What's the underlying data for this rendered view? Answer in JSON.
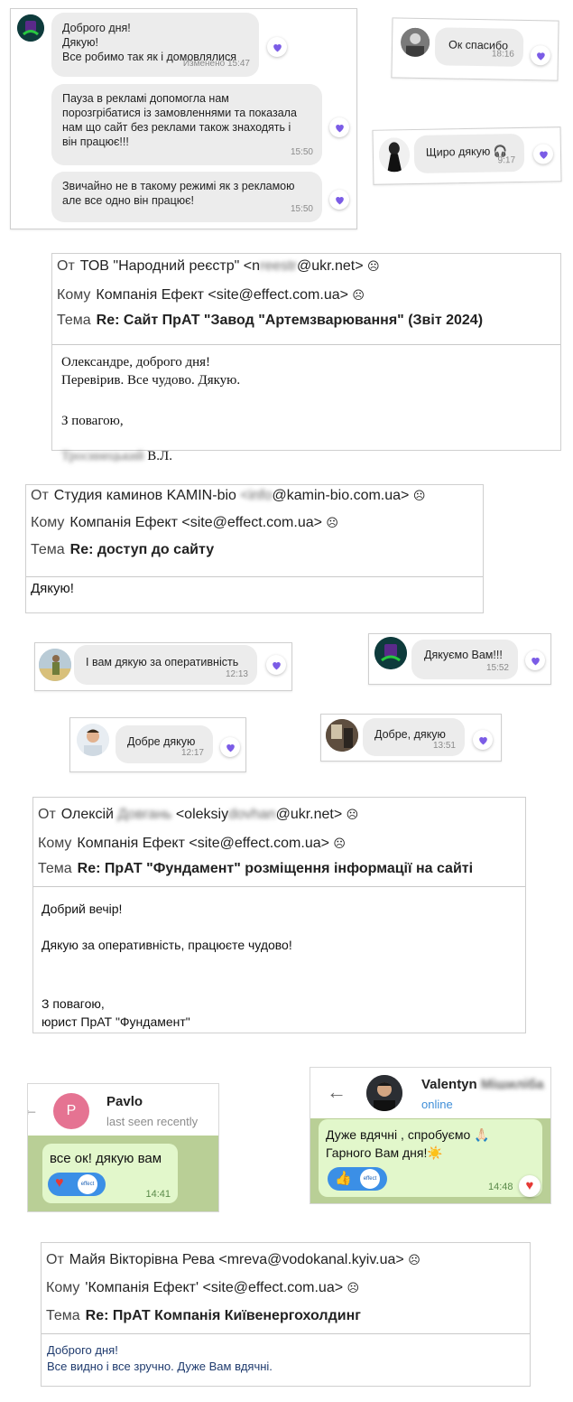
{
  "chat1": {
    "messages": [
      {
        "text": "Доброго дня!\nДякую!\nВсе робимо так як і домовлялися",
        "time": "Изменено 15:47"
      },
      {
        "text": "Пауза в рекламі допомогла нам порозгрібатися із замовленнями та показала нам що сайт без реклами також знаходять і він працює!!!",
        "time": "15:50"
      },
      {
        "text": "Звичайно не в такому режимі як з рекламою але все одно він працює!",
        "time": "15:50"
      }
    ]
  },
  "chat_ok": {
    "text": "Ок спасибо",
    "time": "18:16"
  },
  "chat_shchyro": {
    "text": "Щиро дякую 🎧",
    "time": "9:17"
  },
  "email1": {
    "from_label": "От",
    "from_name": "ТОВ \"Народний реєстр\"",
    "from_email_open": "<n",
    "from_email_blur": "reestr",
    "from_email_close": "@ukr.net>",
    "to_label": "Кому",
    "to": "Компанія Ефект <site@effect.com.ua>",
    "subject_label": "Тема",
    "subject": "Re: Сайт ПрАТ \"Завод \"Артемзварювання\" (Звіт 2024)",
    "body_1": "Олександре, доброго дня!\nПеревірив. Все чудово. Дякую.",
    "body_2": "З повагою,",
    "signature_blur": "Тросинецький",
    "signature_tail": " В.Л."
  },
  "email2": {
    "from_label": "От",
    "from_name": "Студия каминов KAMIN-bio",
    "from_email_blur": "<info",
    "from_email_close": "@kamin-bio.com.ua>",
    "to_label": "Кому",
    "to": "Компанія Ефект <site@effect.com.ua>",
    "subject_label": "Тема",
    "subject": "Re: доступ до сайту",
    "body": "Дякую!"
  },
  "chat_vam": {
    "text": "І вам дякую за оперативність",
    "time": "12:13"
  },
  "chat_dyakuiemo": {
    "text": "Дякуємо Вам!!!",
    "time": "15:52"
  },
  "chat_dobre1": {
    "text": "Добре дякую",
    "time": "12:17"
  },
  "chat_dobre2": {
    "text": "Добре, дякую",
    "time": "13:51"
  },
  "email3": {
    "from_label": "От",
    "from_name": "Олексій",
    "from_name_blur": "Довгань",
    "from_email_open": "<oleksiy",
    "from_email_blur": "dovhan",
    "from_email_close": "@ukr.net>",
    "to_label": "Кому",
    "to": "Компанія Ефект <site@effect.com.ua>",
    "subject_label": "Тема",
    "subject": "Re: ПрАТ \"Фундамент\" розміщення інформації на сайті",
    "body_1": "Добрий вечір!",
    "body_2": "Дякую за оперативність, працюєте чудово!",
    "body_3": "З повагою,\nюрист ПрАТ \"Фундамент\""
  },
  "tg_pavlo": {
    "avatar_letter": "P",
    "name": "Pavlo",
    "status": "last seen recently",
    "message": "все ок! дякую вам",
    "time": "14:41",
    "reaction_logo": "effect"
  },
  "tg_valentyn": {
    "name": "Valentyn",
    "name_blur": "Мішиліба",
    "status": "online",
    "message": "Дуже вдячні , спробуємо 🙏🏻\nГарного Вам дня!☀️",
    "time": "14:48",
    "reaction_logo": "effect"
  },
  "email4": {
    "from_label": "От",
    "from": "Майя Вікторівна Рева <mreva@vodokanal.kyiv.ua>",
    "to_label": "Кому",
    "to": "'Компанія Ефект' <site@effect.com.ua>",
    "subject_label": "Тема",
    "subject": "Re: ПрАТ Компанія Київенергохолдинг",
    "body": "Доброго дня!\nВсе видно і все зручно. Дуже Вам вдячні."
  },
  "colors": {
    "heart": "#7b5ce6",
    "tg_green": "#e2f7cb",
    "tg_blue": "#3b8fe6",
    "accent_red": "#e53935"
  }
}
